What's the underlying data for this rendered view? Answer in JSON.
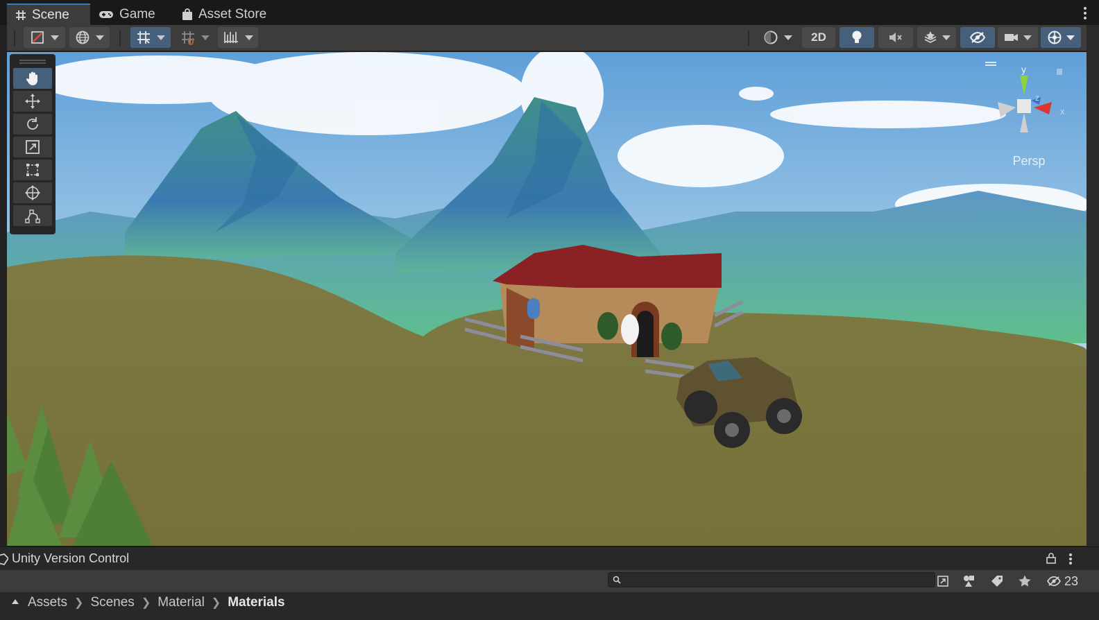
{
  "tabs": [
    {
      "label": "Scene",
      "icon": "grid-hash-icon",
      "active": true
    },
    {
      "label": "Game",
      "icon": "gamepad-icon",
      "active": false
    },
    {
      "label": "Asset Store",
      "icon": "shopping-bag-icon",
      "active": false
    }
  ],
  "toolbar": {
    "mode_2d_label": "2D",
    "accent_color": "#46607c"
  },
  "tools": [
    {
      "name": "hand-tool",
      "icon": "hand-icon",
      "active": true
    },
    {
      "name": "move-tool",
      "icon": "move-arrows-icon",
      "active": false
    },
    {
      "name": "rotate-tool",
      "icon": "rotate-icon",
      "active": false
    },
    {
      "name": "scale-tool",
      "icon": "scale-icon",
      "active": false
    },
    {
      "name": "rect-tool",
      "icon": "rect-transform-icon",
      "active": false
    },
    {
      "name": "transform-tool",
      "icon": "transform-icon",
      "active": false
    },
    {
      "name": "custom-tool",
      "icon": "custom-editor-tool-icon",
      "active": false
    }
  ],
  "gizmo": {
    "y_label": "y",
    "z_label": "z",
    "x_label": "x",
    "projection_label": "Persp"
  },
  "version_control": {
    "title": "Unity Version Control"
  },
  "project": {
    "search_placeholder": "",
    "hidden_count": "23",
    "breadcrumb": [
      "Assets",
      "Scenes",
      "Material",
      "Materials"
    ]
  }
}
